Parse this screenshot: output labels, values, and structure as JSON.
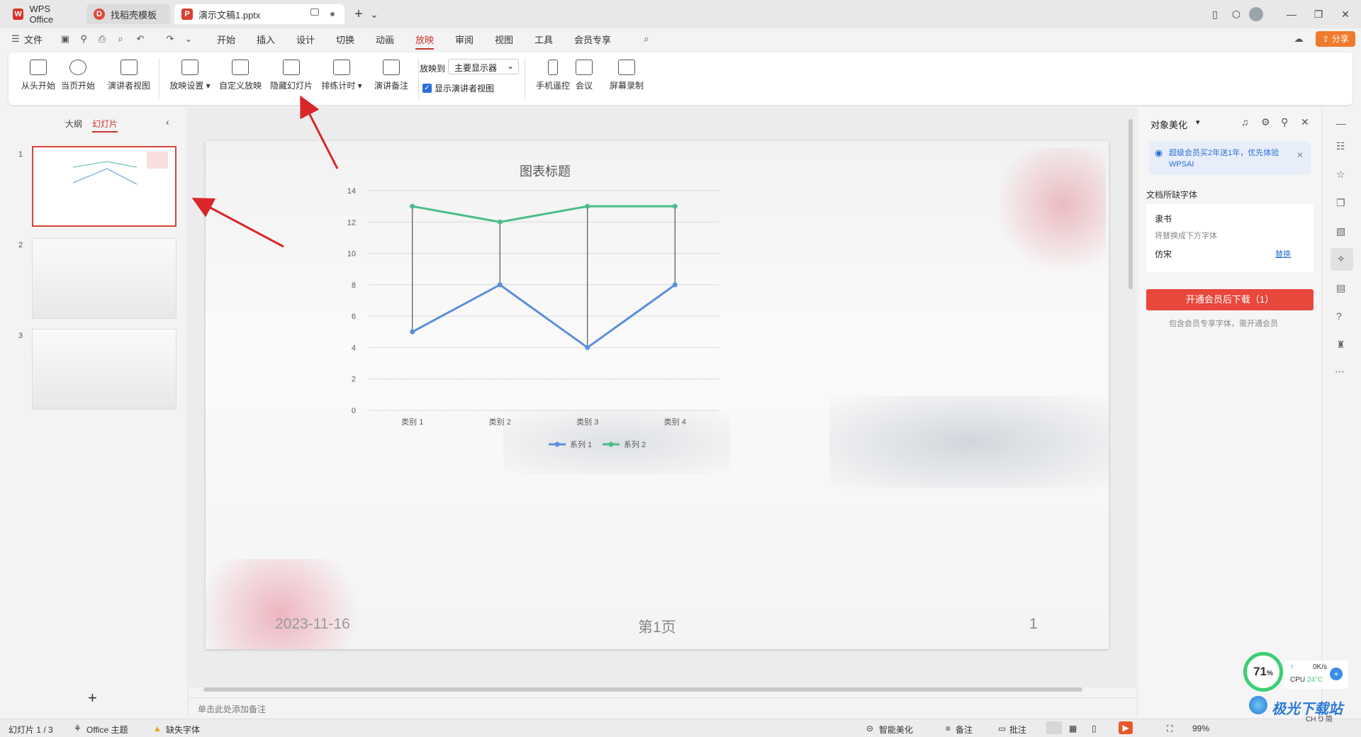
{
  "titlebar": {
    "tabs": [
      {
        "label": "WPS Office",
        "icon": "wps-logo-icon",
        "color": "#d8302a"
      },
      {
        "label": "找稻壳模板",
        "icon": "docer-icon",
        "color": "#e0463c"
      },
      {
        "label": "演示文稿1.pptx",
        "icon": "ppt-file-icon",
        "color": "#d8412f"
      }
    ],
    "new_tab": "+",
    "dropdown": "⌄"
  },
  "menubar": {
    "file": "文件",
    "items": [
      "开始",
      "插入",
      "设计",
      "切换",
      "动画",
      "放映",
      "审阅",
      "视图",
      "工具",
      "会员专享"
    ],
    "active": "放映",
    "share": "分享"
  },
  "ribbon": {
    "buttons": [
      {
        "label": "从头开始",
        "icon": "play-from-start-icon"
      },
      {
        "label": "当页开始",
        "icon": "play-current-icon"
      },
      {
        "label": "演讲者视图",
        "icon": "presenter-view-icon"
      },
      {
        "label": "放映设置",
        "icon": "slideshow-settings-icon",
        "dropdown": true
      },
      {
        "label": "自定义放映",
        "icon": "custom-show-icon"
      },
      {
        "label": "隐藏幻灯片",
        "icon": "hide-slide-icon"
      },
      {
        "label": "排练计时",
        "icon": "rehearse-timing-icon",
        "dropdown": true
      },
      {
        "label": "演讲备注",
        "icon": "speaker-notes-icon"
      },
      {
        "label": "手机遥控",
        "icon": "phone-remote-icon"
      },
      {
        "label": "会议",
        "icon": "meeting-icon"
      },
      {
        "label": "屏幕录制",
        "icon": "screen-record-icon"
      }
    ],
    "play_to_label": "放映到",
    "play_to_value": "主要显示器",
    "presenter_check_label": "显示演讲者视图"
  },
  "leftpanel": {
    "tab_outline": "大纲",
    "tab_slides": "幻灯片",
    "slides": [
      "1",
      "2",
      "3"
    ],
    "add": "+"
  },
  "slide": {
    "date": "2023-11-16",
    "page_label": "第1页",
    "page_number": "1"
  },
  "chart_data": {
    "type": "line",
    "title": "图表标题",
    "categories": [
      "类别 1",
      "类别 2",
      "类别 3",
      "类别 4"
    ],
    "ylim": [
      0,
      14
    ],
    "yticks": [
      0,
      2,
      4,
      6,
      8,
      10,
      12,
      14
    ],
    "series": [
      {
        "name": "系列 1",
        "values": [
          5,
          8,
          4,
          8
        ],
        "color": "#5b8fd9"
      },
      {
        "name": "系列 2",
        "values": [
          13,
          12,
          13,
          13
        ],
        "color": "#4cbd8a"
      }
    ],
    "drop_lines": true,
    "grid": true,
    "legend": "bottom"
  },
  "rightpanel": {
    "title": "对象美化",
    "promo": "超级会员买2年送1年，优先体验WPSAI",
    "missing_fonts_title": "文档所缺字体",
    "font_name": "隶书",
    "replace_hint": "将替换成下方字体",
    "replacement_font": "仿宋",
    "replace_link": "替换",
    "download_button": "开通会员后下载（1）",
    "footnote": "包含会员专享字体，需开通会员"
  },
  "notes": {
    "placeholder": "单击此处添加备注"
  },
  "statusbar": {
    "slide_info": "幻灯片 1 / 3",
    "theme": "Office 主题",
    "missing_font": "缺失字体",
    "smart_beautify": "智能美化",
    "notes": "备注",
    "comments": "批注",
    "zoom": "99%"
  },
  "overlay": {
    "cpu_percent": "71",
    "net_speed": "0K/s",
    "cpu_label": "CPU",
    "cpu_temp": "24°C",
    "watermark": "极光下载站",
    "ime": "CH ⅁ 简"
  }
}
